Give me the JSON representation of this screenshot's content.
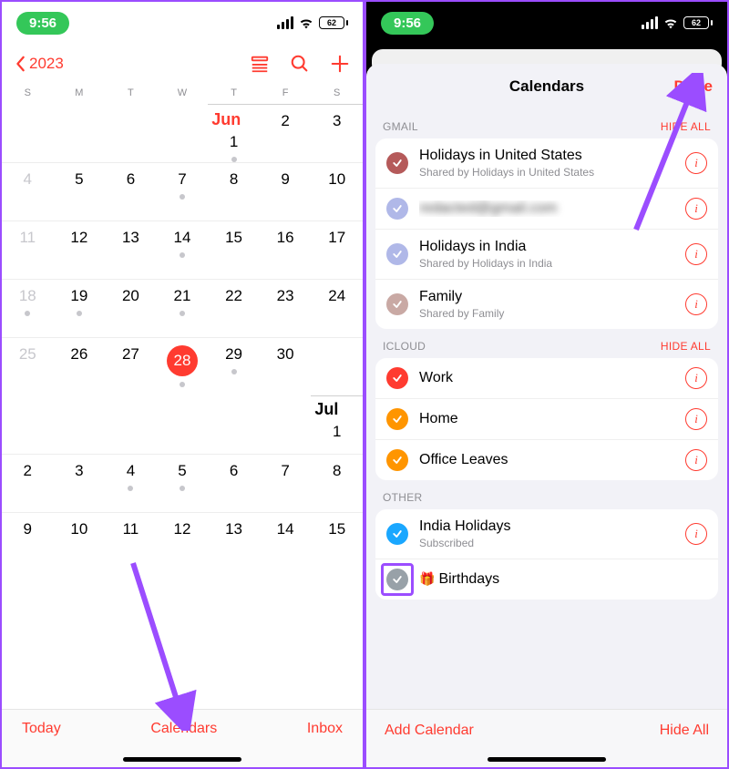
{
  "status": {
    "time": "9:56",
    "battery": "62"
  },
  "left": {
    "back_year": "2023",
    "weekdays": [
      "S",
      "M",
      "T",
      "W",
      "T",
      "F",
      "S"
    ],
    "months": {
      "jun": "Jun",
      "jul": "Jul"
    },
    "rows": [
      [
        {
          "n": ""
        },
        {
          "n": ""
        },
        {
          "n": ""
        },
        {
          "n": ""
        },
        {
          "n": "1",
          "dot": true
        },
        {
          "n": "2"
        },
        {
          "n": "3"
        }
      ],
      [
        {
          "n": "4",
          "dim": true
        },
        {
          "n": "5"
        },
        {
          "n": "6"
        },
        {
          "n": "7",
          "dot": true
        },
        {
          "n": "8"
        },
        {
          "n": "9"
        },
        {
          "n": "10"
        }
      ],
      [
        {
          "n": "11",
          "dim": true
        },
        {
          "n": "12"
        },
        {
          "n": "13"
        },
        {
          "n": "14",
          "dot": true
        },
        {
          "n": "15"
        },
        {
          "n": "16"
        },
        {
          "n": "17"
        }
      ],
      [
        {
          "n": "18",
          "dim": true,
          "dot": true
        },
        {
          "n": "19",
          "dot": true
        },
        {
          "n": "20"
        },
        {
          "n": "21",
          "dot": true
        },
        {
          "n": "22"
        },
        {
          "n": "23"
        },
        {
          "n": "24"
        }
      ],
      [
        {
          "n": "25",
          "dim": true
        },
        {
          "n": "26"
        },
        {
          "n": "27"
        },
        {
          "n": "28",
          "today": true,
          "dot": true
        },
        {
          "n": "29",
          "dot": true
        },
        {
          "n": "30"
        },
        {
          "n": ""
        }
      ],
      [
        {
          "n": ""
        },
        {
          "n": ""
        },
        {
          "n": ""
        },
        {
          "n": ""
        },
        {
          "n": ""
        },
        {
          "n": ""
        },
        {
          "n": "1"
        }
      ],
      [
        {
          "n": "2"
        },
        {
          "n": "3"
        },
        {
          "n": "4",
          "dot": true
        },
        {
          "n": "5",
          "dot": true
        },
        {
          "n": "6"
        },
        {
          "n": "7"
        },
        {
          "n": "8"
        }
      ],
      [
        {
          "n": "9"
        },
        {
          "n": "10"
        },
        {
          "n": "11"
        },
        {
          "n": "12"
        },
        {
          "n": "13"
        },
        {
          "n": "14"
        },
        {
          "n": "15"
        }
      ]
    ],
    "toolbar": {
      "today": "Today",
      "calendars": "Calendars",
      "inbox": "Inbox"
    }
  },
  "right": {
    "title": "Calendars",
    "done": "Done",
    "sections": [
      {
        "name": "GMAIL",
        "hide": "HIDE ALL",
        "items": [
          {
            "color": "#b55a5a",
            "title": "Holidays in United States",
            "sub": "Shared by Holidays in United States"
          },
          {
            "color": "#b0b8e8",
            "title": "redacted@gmail.com",
            "sub": "",
            "blur": true
          },
          {
            "color": "#b0b8e8",
            "title": "Holidays in India",
            "sub": "Shared by Holidays in India"
          },
          {
            "color": "#c9a9a4",
            "title": "Family",
            "sub": "Shared by Family"
          }
        ]
      },
      {
        "name": "ICLOUD",
        "hide": "HIDE ALL",
        "items": [
          {
            "color": "#ff3b30",
            "title": "Work"
          },
          {
            "color": "#ff9500",
            "title": "Home"
          },
          {
            "color": "#ff9500",
            "title": "Office Leaves"
          }
        ]
      },
      {
        "name": "OTHER",
        "hide": "",
        "items": [
          {
            "color": "#1aa7ff",
            "title": "India Holidays",
            "sub": "Subscribed"
          },
          {
            "color": "#98a1a8",
            "title": "Birthdays",
            "gift": true,
            "highlight": true,
            "noinfo": true
          }
        ]
      }
    ],
    "bottom": {
      "add": "Add Calendar",
      "hideall": "Hide All"
    }
  }
}
